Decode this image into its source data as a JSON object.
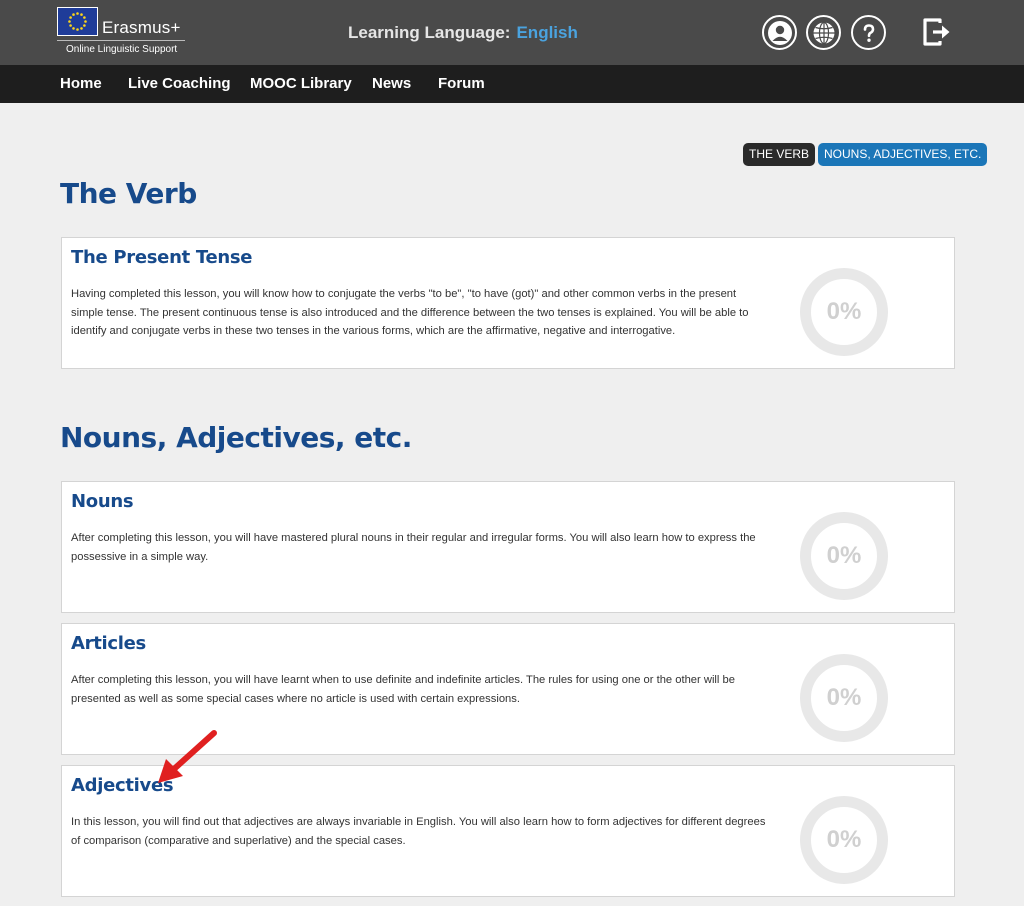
{
  "header": {
    "logo_text": "Erasmus+",
    "logo_subtitle": "Online Linguistic Support",
    "learning_label": "Learning Language:",
    "learning_value": "English"
  },
  "nav": [
    "Home",
    "Live Coaching",
    "MOOC Library",
    "News",
    "Forum"
  ],
  "filters": [
    "THE VERB",
    "NOUNS, ADJECTIVES, ETC."
  ],
  "sections": [
    {
      "title": "The Verb",
      "lessons": [
        {
          "title": "The Present Tense",
          "description": "Having completed this lesson, you will know how to conjugate the verbs \"to be\", \"to have (got)\" and other common verbs in the present simple tense. The present continuous tense is also introduced and the difference between the two tenses is explained. You will be able to identify and conjugate verbs in these two tenses in the various forms, which are the affirmative, negative and interrogative.",
          "progress": "0%"
        }
      ]
    },
    {
      "title": "Nouns, Adjectives, etc.",
      "lessons": [
        {
          "title": "Nouns",
          "description": "After completing this lesson, you will have mastered plural nouns in their regular and irregular forms. You will also learn how to express the possessive in a simple way.",
          "progress": "0%"
        },
        {
          "title": "Articles",
          "description": "After completing this lesson, you will have learnt when to use definite and indefinite articles. The rules for using one or the other will be presented as well as some special cases where no article is used with certain expressions.",
          "progress": "0%"
        },
        {
          "title": "Adjectives",
          "description": "In this lesson, you will find out that adjectives are always invariable in English. You will also learn how to form adjectives for different degrees of comparison (comparative and superlative) and the special cases.",
          "progress": "0%"
        }
      ]
    }
  ],
  "colors": {
    "header_bg": "#4a4a4a",
    "nav_bg": "#1e1e1e",
    "accent_blue": "#174a8b",
    "language_blue": "#4aa3df",
    "tag_active": "#1b76b8",
    "annotation_arrow": "#e02020"
  },
  "icons": [
    "eu-flag-icon",
    "user-icon",
    "globe-icon",
    "help-icon",
    "logout-icon",
    "annotation-arrow-icon"
  ]
}
